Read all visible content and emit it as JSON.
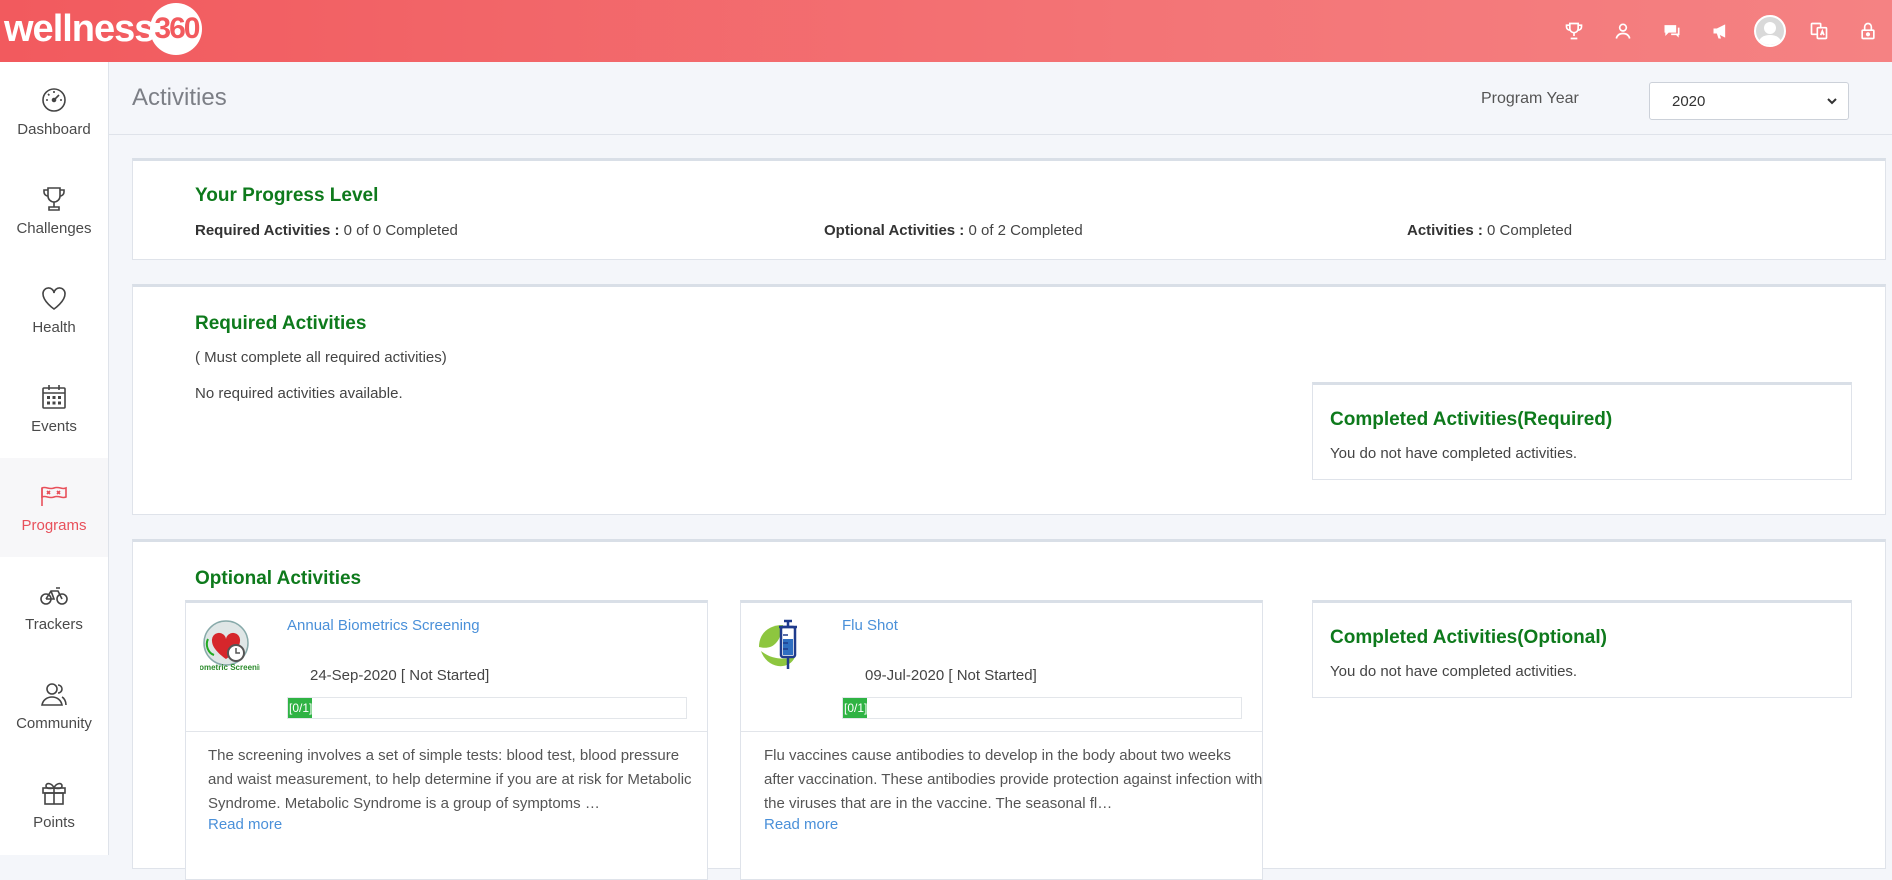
{
  "header": {
    "logo_text": "wellness",
    "logo_number": "360",
    "icons": [
      "trophy-icon",
      "user-icon",
      "chat-icon",
      "megaphone-icon",
      "avatar",
      "translate-icon",
      "lock-icon"
    ]
  },
  "sidebar": {
    "items": [
      {
        "label": "Dashboard",
        "icon": "dashboard-icon"
      },
      {
        "label": "Challenges",
        "icon": "trophy-icon"
      },
      {
        "label": "Health",
        "icon": "heart-icon"
      },
      {
        "label": "Events",
        "icon": "calendar-icon"
      },
      {
        "label": "Programs",
        "icon": "flag-icon",
        "active": true
      },
      {
        "label": "Trackers",
        "icon": "bicycle-icon"
      },
      {
        "label": "Community",
        "icon": "community-icon"
      },
      {
        "label": "Points",
        "icon": "gift-icon"
      }
    ]
  },
  "page": {
    "title": "Activities",
    "program_year_label": "Program Year",
    "program_year_value": "2020"
  },
  "progress": {
    "title": "Your Progress Level",
    "required_label": "Required Activities :",
    "required_value": "0 of 0 Completed",
    "optional_label": "Optional Activities :",
    "optional_value": "0 of 2 Completed",
    "activities_label": "Activities :",
    "activities_value": "0 Completed"
  },
  "required": {
    "title": "Required Activities",
    "note": "( Must complete all required activities)",
    "empty": "No required activities available.",
    "completed_title": "Completed Activities(Required)",
    "completed_empty": "You do not have completed activities."
  },
  "optional": {
    "title": "Optional Activities",
    "completed_title": "Completed Activities(Optional)",
    "completed_empty": "You do not have completed activities.",
    "activities": [
      {
        "title": "Annual Biometrics Screening",
        "date_status": "24-Sep-2020 [ Not Started]",
        "progress_label": "[0/1]",
        "progress": 0,
        "description": "The screening involves a set of simple tests: blood test, blood pressure and waist measurement, to help determine if you are at risk for Metabolic Syndrome. Metabolic Syndrome is a group of symptoms …",
        "read_more": "Read more",
        "thumb_text": "Biometric Screening"
      },
      {
        "title": "Flu Shot",
        "date_status": "09-Jul-2020 [ Not Started]",
        "progress_label": "[0/1]",
        "progress": 0,
        "description": "Flu vaccines cause antibodies to develop in the body about two weeks after vaccination. These antibodies provide protection against infection with the viruses that are in the vaccine. The seasonal fl…",
        "read_more": "Read more"
      }
    ]
  },
  "colors": {
    "header_start": "#f25a5e",
    "header_end": "#f58283",
    "heading_green": "#0e7a1c",
    "link_blue": "#4a90d9",
    "progress_green": "#2fb344",
    "active_red": "#e8505b"
  }
}
